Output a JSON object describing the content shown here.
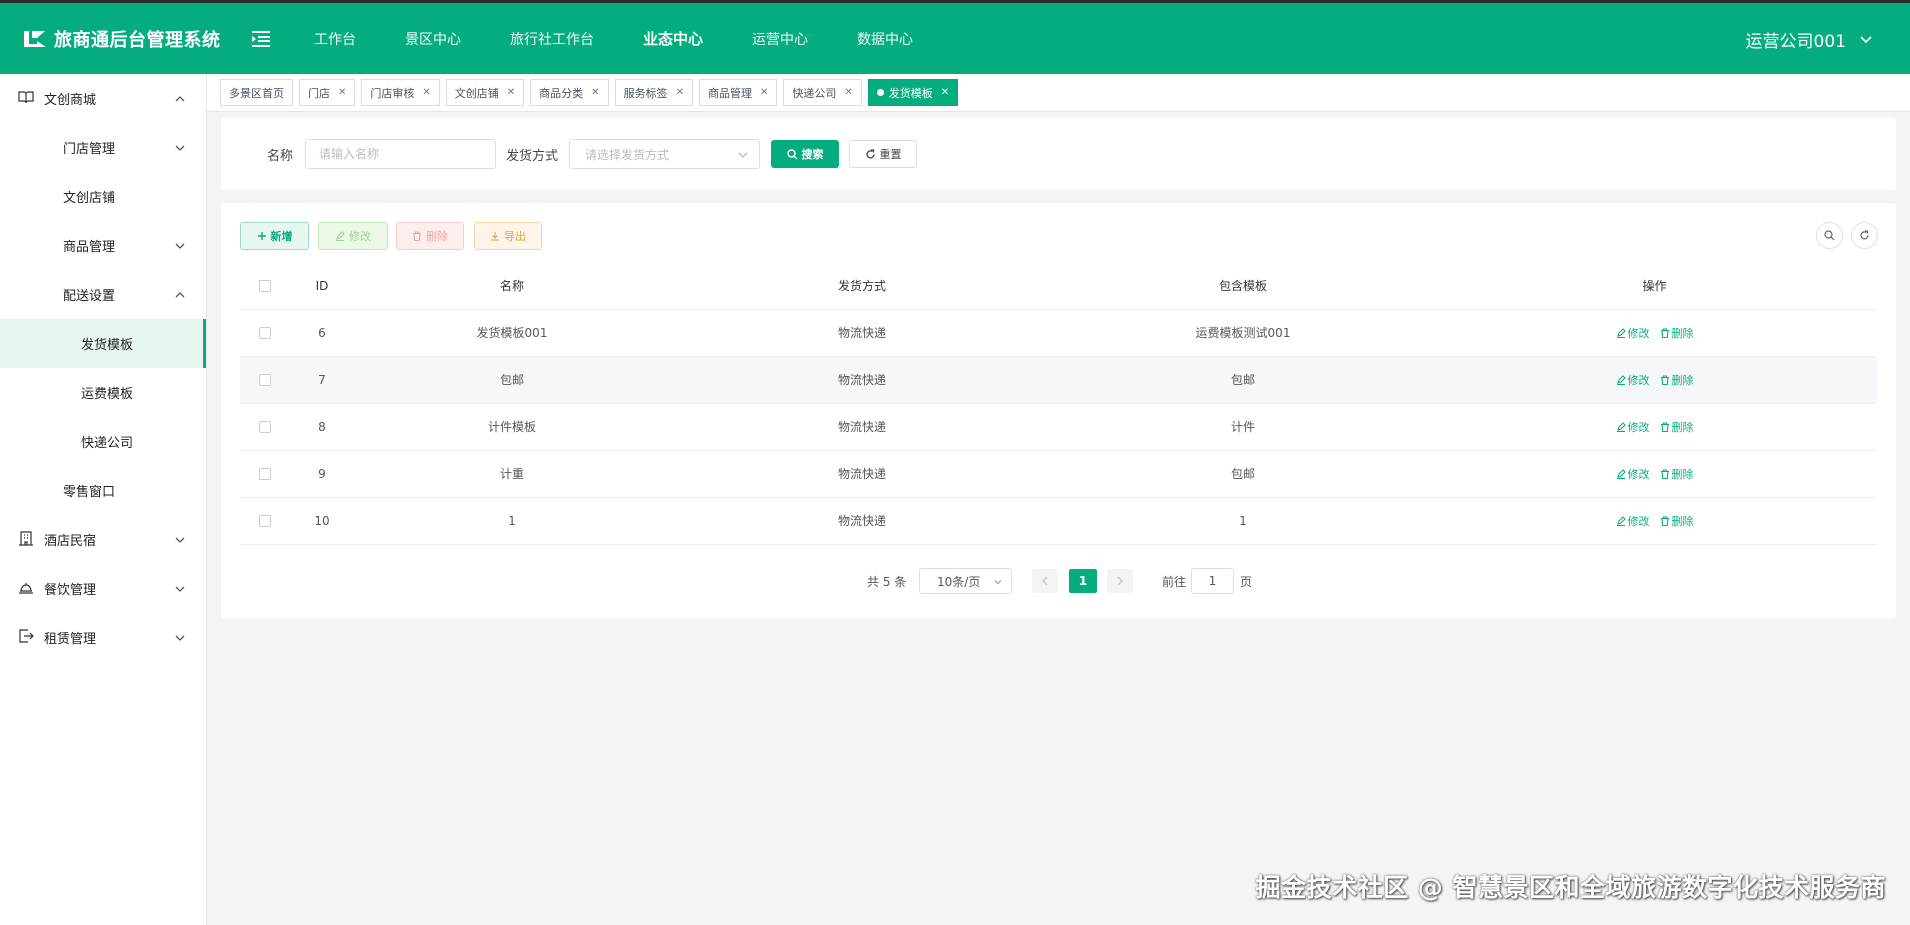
{
  "app": {
    "title": "旅商通后台管理系统",
    "brand_color": "#05ad7e",
    "user": "运营公司001"
  },
  "topnav": {
    "items": [
      {
        "label": "工作台"
      },
      {
        "label": "景区中心"
      },
      {
        "label": "旅行社工作台"
      },
      {
        "label": "业态中心",
        "active": true
      },
      {
        "label": "运营中心"
      },
      {
        "label": "数据中心"
      }
    ]
  },
  "sidebar": {
    "wenchuang": "文创商城",
    "store_mgmt": "门店管理",
    "wenchuang_store": "文创店铺",
    "goods_mgmt": "商品管理",
    "delivery_settings": "配送设置",
    "shipping_template": "发货模板",
    "freight_template": "运费模板",
    "courier": "快递公司",
    "retail_window": "零售窗口",
    "hotel": "酒店民宿",
    "catering": "餐饮管理",
    "rental": "租赁管理"
  },
  "tabs": [
    {
      "label": "多景区首页",
      "closable": false
    },
    {
      "label": "门店",
      "closable": true
    },
    {
      "label": "门店审核",
      "closable": true
    },
    {
      "label": "文创店铺",
      "closable": true
    },
    {
      "label": "商品分类",
      "closable": true
    },
    {
      "label": "服务标签",
      "closable": true
    },
    {
      "label": "商品管理",
      "closable": true
    },
    {
      "label": "快递公司",
      "closable": true
    },
    {
      "label": "发货模板",
      "closable": true,
      "active": true
    }
  ],
  "search": {
    "name_label": "名称",
    "name_placeholder": "请输入名称",
    "method_label": "发货方式",
    "method_placeholder": "请选择发货方式",
    "search_btn": "搜索",
    "reset_btn": "重置"
  },
  "toolbar": {
    "add": "新增",
    "edit": "修改",
    "delete": "删除",
    "export": "导出"
  },
  "table": {
    "headers": {
      "id": "ID",
      "name": "名称",
      "method": "发货方式",
      "template": "包含模板",
      "ops": "操作"
    },
    "op_edit": "修改",
    "op_delete": "删除",
    "rows": [
      {
        "id": "6",
        "name": "发货模板001",
        "method": "物流快递",
        "template": "运费模板测试001"
      },
      {
        "id": "7",
        "name": "包邮",
        "method": "物流快递",
        "template": "包邮"
      },
      {
        "id": "8",
        "name": "计件模板",
        "method": "物流快递",
        "template": "计件"
      },
      {
        "id": "9",
        "name": "计重",
        "method": "物流快递",
        "template": "包邮"
      },
      {
        "id": "10",
        "name": "1",
        "method": "物流快递",
        "template": "1"
      }
    ]
  },
  "pagination": {
    "total": "共 5 条",
    "page_size": "10条/页",
    "current": "1",
    "goto": "前往",
    "goto_value": "1",
    "unit": "页"
  },
  "watermark": "掘金技术社区 @ 智慧景区和全域旅游数字化技术服务商"
}
